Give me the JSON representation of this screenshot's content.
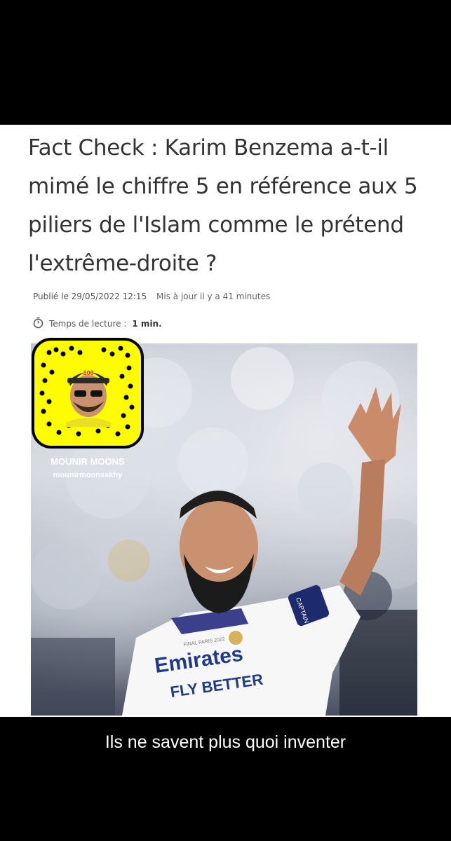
{
  "article": {
    "headline": "Fact Check : Karim Benzema a-t-il mimé le chiffre 5 en référence aux 5 piliers de l'Islam comme le prétend l'extrême-droite ?",
    "published": "Publié le 29/05/2022 12:15",
    "updated": "Mis à jour il y a 41 minutes",
    "reading_label": "Temps de lecture :",
    "reading_value": "1 min."
  },
  "jersey": {
    "sponsor": "Emirates",
    "tagline": "FLY BETTER",
    "badge": "FINAL PARIS 2022"
  },
  "armband": "CAPTAIN",
  "snapcode": {
    "display_name": "MOUNIR MOONS",
    "username": "mounirmoonsakhy",
    "cap_text": "100",
    "color": "#FFFC00"
  },
  "caption": "Ils ne savent plus quoi inventer"
}
